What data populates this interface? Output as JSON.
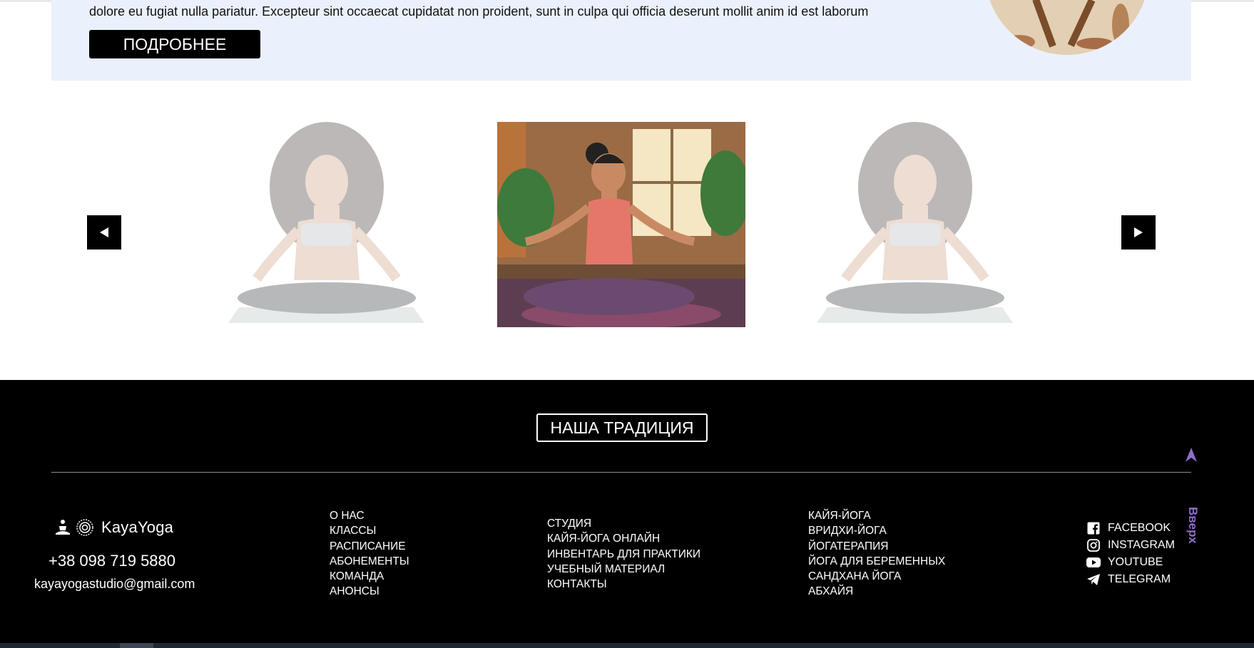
{
  "promo": {
    "text": "dolore eu fugiat nulla pariatur. Excepteur sint occaecat cupidatat non proident, sunt in culpa qui officia deserunt mollit anim id est laborum",
    "button_label": "ПОДРОБНЕЕ"
  },
  "carousel": {
    "prev_icon": "triangle-left-icon",
    "next_icon": "triangle-right-icon"
  },
  "footer": {
    "tradition_label": "НАША ТРАДИЦИЯ",
    "up_label": "Вверх",
    "logo_text": "KayaYoga",
    "phone": "+38 098 719 5880",
    "email": "kayayogastudio@gmail.com",
    "col1": [
      "О НАС",
      "КЛАССЫ",
      "РАСПИСАНИЕ",
      "АБОНЕМЕНТЫ",
      "КОМАНДА",
      "АНОНСЫ"
    ],
    "col2": [
      "СТУДИЯ",
      "КАЙЯ-ЙОГА ОНЛАЙН",
      "ИНВЕНТАРЬ ДЛЯ ПРАКТИКИ",
      "УЧЕБНЫЙ МАТЕРИАЛ",
      "КОНТАКТЫ"
    ],
    "col3": [
      "КАЙЯ-ЙОГА",
      "ВРИДХИ-ЙОГА",
      "ЙОГАТЕРАПИЯ",
      "ЙОГА ДЛЯ БЕРЕМЕННЫХ",
      "САНДХАНА ЙОГА",
      "АБХАЙЯ"
    ],
    "social": [
      {
        "label": "FACEBOOK",
        "icon": "facebook-icon"
      },
      {
        "label": "INSTAGRAM",
        "icon": "instagram-icon"
      },
      {
        "label": "YOUTUBE",
        "icon": "youtube-icon"
      },
      {
        "label": "TELEGRAM",
        "icon": "telegram-icon"
      }
    ]
  },
  "colors": {
    "promo_bg": "#eaf1fc",
    "footer_bg": "#000000",
    "accent_purple": "#8e6fc8"
  }
}
